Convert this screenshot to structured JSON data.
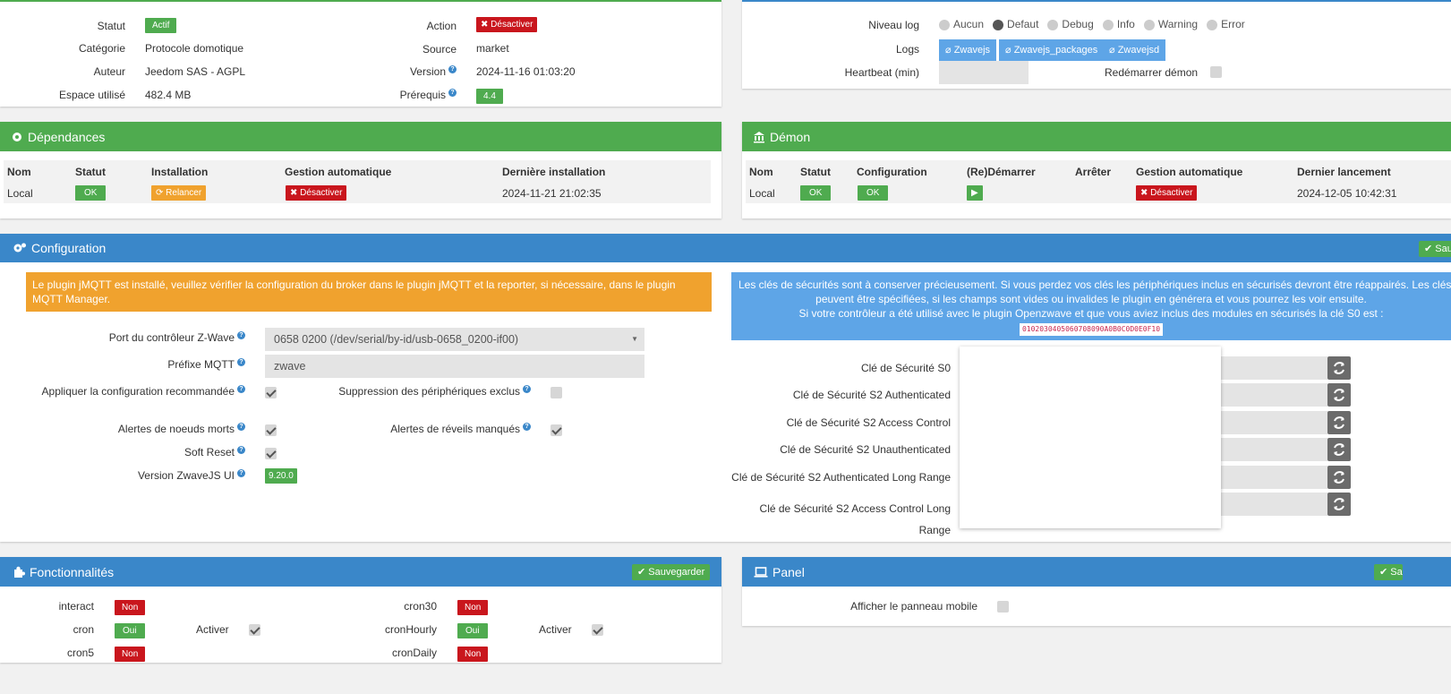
{
  "info": {
    "statut_label": "Statut",
    "statut_value": "Actif",
    "categorie_label": "Catégorie",
    "categorie_value": "Protocole domotique",
    "auteur_label": "Auteur",
    "auteur_value": "Jeedom SAS - AGPL",
    "espace_label": "Espace utilisé",
    "espace_value": "482.4 MB",
    "action_label": "Action",
    "action_value": "Désactiver",
    "source_label": "Source",
    "source_value": "market",
    "version_label": "Version",
    "version_value": "2024-11-16 01:03:20",
    "prerequis_label": "Prérequis",
    "prerequis_value": "4.4"
  },
  "logs": {
    "niveau_label": "Niveau log",
    "levels": [
      "Aucun",
      "Defaut",
      "Debug",
      "Info",
      "Warning",
      "Error"
    ],
    "selected": "Defaut",
    "logs_label": "Logs",
    "buttons": [
      "Zwavejs",
      "Zwavejs_packages",
      "Zwavejsd"
    ],
    "heartbeat_label": "Heartbeat (min)",
    "redemarrer_label": "Redémarrer démon"
  },
  "dependances": {
    "title": "Dépendances",
    "headers": [
      "Nom",
      "Statut",
      "Installation",
      "Gestion automatique",
      "Dernière installation"
    ],
    "row": {
      "nom": "Local",
      "statut": "OK",
      "installation": "Relancer",
      "gestion": "Désactiver",
      "derniere": "2024-11-21 21:02:35"
    }
  },
  "demon": {
    "title": "Démon",
    "headers": [
      "Nom",
      "Statut",
      "Configuration",
      "(Re)Démarrer",
      "Arrêter",
      "Gestion automatique",
      "Dernier lancement"
    ],
    "row": {
      "nom": "Local",
      "statut": "OK",
      "configuration": "OK",
      "gestion": "Désactiver",
      "dernier": "2024-12-05 10:42:31"
    }
  },
  "configuration": {
    "title": "Configuration",
    "save_label": "Sau",
    "warning": "Le plugin jMQTT est installé, veuillez vérifier la configuration du broker dans le plugin jMQTT et la reporter, si nécessaire, dans le plugin MQTT Manager.",
    "info_line1": "Les clés de sécurités sont à conserver précieusement. Si vous perdez vos clés les périphériques inclus en sécurisés devront être réappairés. Les clés",
    "info_line2": "peuvent être spécifiées, si les champs sont vides ou invalides le plugin en générera et vous pourrez les voir ensuite.",
    "info_line3": "Si votre contrôleur a été utilisé avec le plugin Openzwave et que vous aviez inclus des modules en sécurisés la clé S0 est :",
    "s0_code": "0102030405060708090A0B0C0D0E0F10",
    "port_label": "Port du contrôleur Z-Wave",
    "port_value": "0658 0200 (/dev/serial/by-id/usb-0658_0200-if00)",
    "prefixe_label": "Préfixe MQTT",
    "prefixe_value": "zwave",
    "appliquer_label": "Appliquer la configuration recommandée",
    "suppression_label": "Suppression des périphériques exclus",
    "alertes_morts_label": "Alertes de noeuds morts",
    "alertes_reveils_label": "Alertes de réveils manqués",
    "soft_reset_label": "Soft Reset",
    "version_ui_label": "Version ZwaveJS UI",
    "version_ui_value": "9.20.0",
    "keys": [
      "Clé de Sécurité S0",
      "Clé de Sécurité S2 Authenticated",
      "Clé de Sécurité S2 Access Control",
      "Clé de Sécurité S2 Unauthenticated",
      "Clé de Sécurité S2 Authenticated Long Range",
      "Clé de Sécurité S2 Access Control Long"
    ],
    "key_last_line2": "Range"
  },
  "fonctionnalites": {
    "title": "Fonctionnalités",
    "save_label": "Sauvegarder",
    "interact": "interact",
    "interact_v": "Non",
    "cron": "cron",
    "cron_v": "Oui",
    "cron_activer": "Activer",
    "cron5": "cron5",
    "cron5_v": "Non",
    "cron30": "cron30",
    "cron30_v": "Non",
    "cronHourly": "cronHourly",
    "cronHourly_v": "Oui",
    "cronHourly_activer": "Activer",
    "cronDaily": "cronDaily",
    "cronDaily_v": "Non"
  },
  "panel": {
    "title": "Panel",
    "save_label": "Sa",
    "afficher_label": "Afficher le panneau mobile"
  },
  "colors": {
    "green": "#4fab4f",
    "blue": "#3a87c9",
    "red": "#c9161d",
    "orange": "#f0a22e",
    "lightblue": "#5ea5e7"
  }
}
